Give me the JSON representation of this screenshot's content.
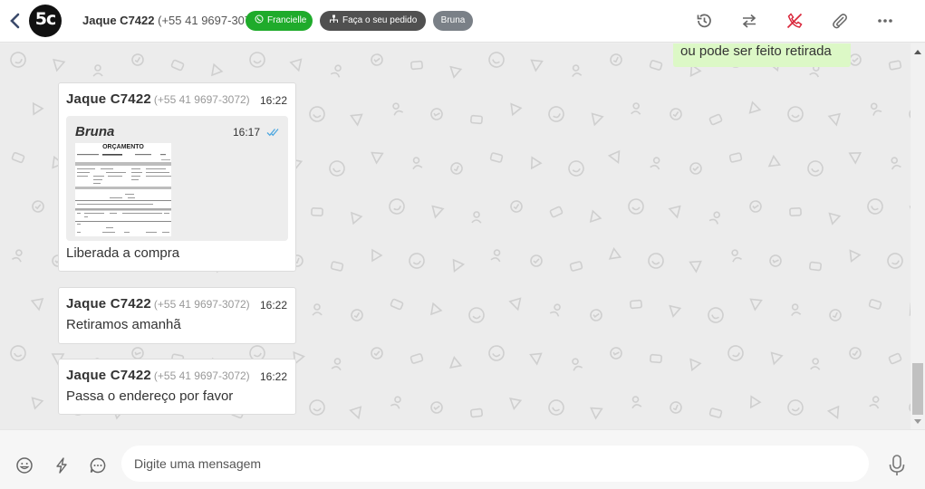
{
  "header": {
    "back_icon": "chevron-left-icon",
    "avatar_text": "5c",
    "contact_name": "Jaque C7422",
    "contact_phone": "(+55 41 9697-3072)",
    "tags": [
      {
        "label": "Francielle",
        "icon": "whatsapp-icon",
        "color": "#1fab2b"
      },
      {
        "label": "Faça o seu pedido",
        "icon": "sitemap-icon",
        "color": "#505050"
      },
      {
        "label": "Bruna",
        "color": "#7a8087"
      }
    ],
    "actions": [
      "history-icon",
      "transfer-icon",
      "end-call-icon",
      "paperclip-icon",
      "more-icon"
    ],
    "end_call_color": "#d9263a"
  },
  "messages": {
    "outgoing_partial": {
      "text": "ou pode ser feito retirada"
    },
    "items": [
      {
        "sender": "Jaque C7422",
        "phone": "(+55 41 9697-3072)",
        "time": "16:22",
        "quoted": {
          "sender": "Bruna",
          "time": "16:17",
          "doc_title": "ORÇAMENTO"
        },
        "text": "Liberada a compra"
      },
      {
        "sender": "Jaque C7422",
        "phone": "(+55 41 9697-3072)",
        "time": "16:22",
        "text": "Retiramos amanhã"
      },
      {
        "sender": "Jaque C7422",
        "phone": "(+55 41 9697-3072)",
        "time": "16:22",
        "text": "Passa o endereço por favor"
      }
    ]
  },
  "composer": {
    "placeholder": "Digite uma mensagem",
    "left_icons": [
      "emoji-icon",
      "lightning-icon",
      "quick-reply-icon"
    ],
    "right_icon": "microphone-icon"
  },
  "colors": {
    "tick_blue": "#4fa8e0",
    "outgoing_bg": "#dcf8c6"
  }
}
